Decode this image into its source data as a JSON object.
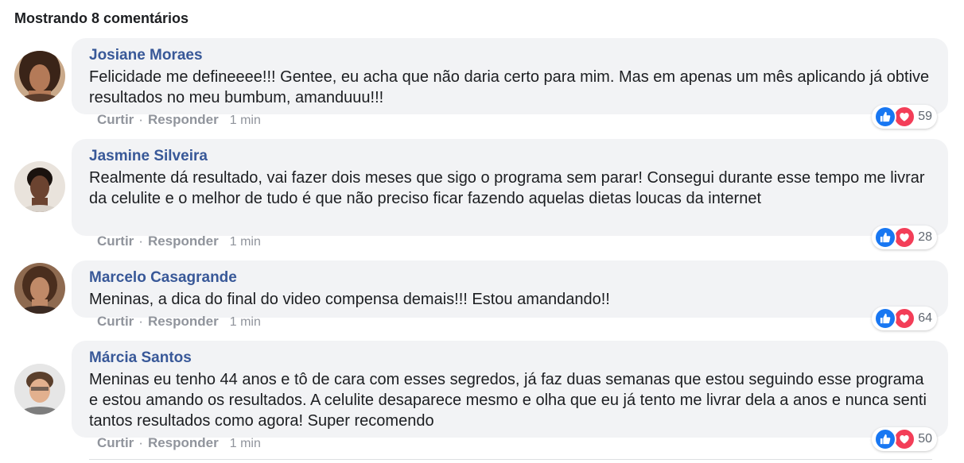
{
  "header": {
    "title": "Mostrando 8 comentários"
  },
  "actions": {
    "like_label": "Curtir",
    "reply_label": "Responder",
    "separator": "·"
  },
  "colors": {
    "author": "#385898",
    "bubble": "#f2f3f5",
    "like": "#1877f2",
    "love": "#f33e58"
  },
  "comments": [
    {
      "author": "Josiane Moraes",
      "text": "Felicidade me defineeee!!! Gentee, eu acha que não daria certo para mim. Mas em apenas um mês aplicando já obtive resultados no meu bumbum, amanduuu!!!",
      "time": "1 min",
      "reactions": "59"
    },
    {
      "author": "Jasmine Silveira",
      "text": "Realmente dá resultado, vai fazer dois meses que sigo o programa sem parar! Consegui durante esse tempo me livrar da celulite e o melhor de tudo é que não preciso ficar fazendo aquelas dietas loucas da internet",
      "time": "1 min",
      "reactions": "28"
    },
    {
      "author": "Marcelo Casagrande",
      "text": "Meninas, a dica do final do video compensa demais!!! Estou amandando!!",
      "time": "1 min",
      "reactions": "64"
    },
    {
      "author": "Márcia Santos",
      "text": "Meninas eu tenho 44 anos e tô de cara com esses segredos, já faz duas semanas que estou seguindo esse programa e estou amando os resultados. A celulite desaparece mesmo e olha que eu já tento me livrar dela a anos e nunca senti tantos resultados como agora! Super recomendo",
      "time": "1 min",
      "reactions": "50"
    }
  ]
}
